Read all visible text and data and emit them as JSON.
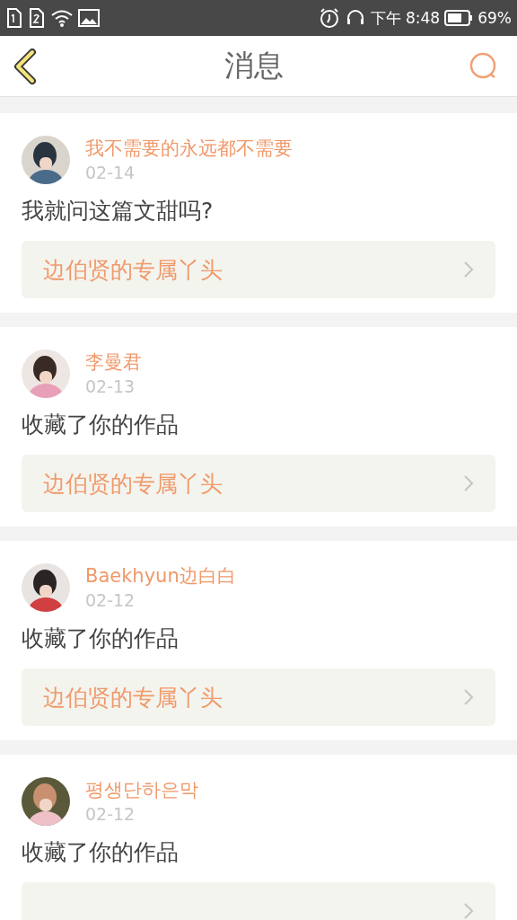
{
  "status_bar": {
    "time": "下午 8:48",
    "battery": "69%"
  },
  "header": {
    "title": "消息"
  },
  "messages": [
    {
      "user": "我不需要的永远都不需要",
      "date": "02-14",
      "text": "我就问这篇文甜吗?",
      "work": "边伯贤的专属丫头"
    },
    {
      "user": "李曼君",
      "date": "02-13",
      "text": "收藏了你的作品",
      "work": "边伯贤的专属丫头"
    },
    {
      "user": "Baekhyun边白白",
      "date": "02-12",
      "text": "收藏了你的作品",
      "work": "边伯贤的专属丫头"
    },
    {
      "user": "평생단하은막",
      "date": "02-12",
      "text": "收藏了你的作品"
    }
  ]
}
